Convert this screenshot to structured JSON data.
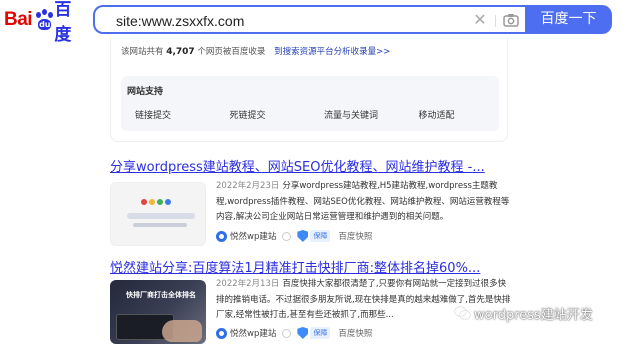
{
  "logo": {
    "brand_latin": "Bai",
    "paw_char": "du",
    "brand_cn": "百度"
  },
  "search": {
    "query": "site:www.zsxxfx.com",
    "button_label": "百度一下",
    "clear_glyph": "✕"
  },
  "site_info": {
    "summary_prefix": "该网站共有",
    "page_count": "4,707",
    "summary_suffix": "个网页被百度收录",
    "analysis_link": "到搜索资源平台分析收录量>>",
    "support_title": "网站支持",
    "support_links": [
      "链接提交",
      "死链提交",
      "流量与关键词",
      "移动适配"
    ]
  },
  "results": [
    {
      "title": "分享wordpress建站教程、网站SEO优化教程、网站维护教程 -...",
      "date": "2022年2月23日",
      "abstract": "分享wordpress建站教程,H5建站教程,wordpress主题教程,wordpress插件教程、网站SEO优化教程、网站维护教程、网站运营教程等内容,解决公司企业网站日常运营管理和维护遇到的相关问题。",
      "source": "悦然wp建站",
      "badge": "保障",
      "snapshot": "百度快照"
    },
    {
      "title": "悦然建站分享:百度算法1月精准打击快排厂商:整体排名掉60%...",
      "date": "2022年2月13日",
      "abstract": "百度快排大家都很清楚了,只要你有网站就一定接到过很多快排的推销电话。不过据很多朋友所说,现在快排是真的越来越难做了,首先是快排厂家,经常性被打击,甚至有些还被抓了,而那些...",
      "thumb_caption": "快排厂商打击全体排名",
      "source": "悦然wp建站",
      "badge": "保障",
      "snapshot": "百度快照"
    }
  ],
  "watermark": {
    "text": "wordpress建站开发"
  },
  "colors": {
    "brand_blue": "#4e6ef2",
    "link": "#2b2fe0",
    "logo_red": "#e10602",
    "logo_blue": "#2932e1"
  }
}
